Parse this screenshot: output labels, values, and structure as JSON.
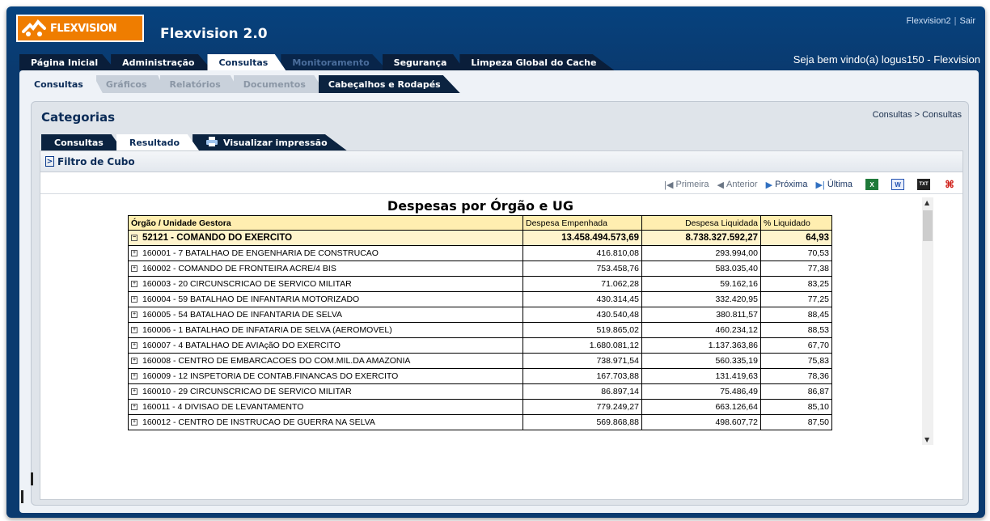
{
  "header": {
    "brand": "FLEXVISION",
    "app_title": "Flexvision 2.0",
    "user_link": "Flexvision2",
    "logout_link": "Sair",
    "welcome": "Seja bem vindo(a) logus150 - Flexvision"
  },
  "main_tabs": [
    {
      "label": "Página Inicial",
      "state": "normal"
    },
    {
      "label": "Administração",
      "state": "normal"
    },
    {
      "label": "Consultas",
      "state": "active"
    },
    {
      "label": "Monitoramento",
      "state": "disabled"
    },
    {
      "label": "Segurança",
      "state": "normal"
    },
    {
      "label": "Limpeza Global do Cache",
      "state": "normal"
    }
  ],
  "sub_tabs": [
    {
      "label": "Consultas",
      "state": "active"
    },
    {
      "label": "Gráficos",
      "state": "inactive"
    },
    {
      "label": "Relatórios",
      "state": "inactive"
    },
    {
      "label": "Documentos",
      "state": "inactive"
    },
    {
      "label": "Cabeçalhos e Rodapés",
      "state": "dark"
    }
  ],
  "section": {
    "title": "Categorias",
    "breadcrumb": "Consultas > Consultas"
  },
  "result_tabs": [
    {
      "label": "Consultas",
      "state": "normal"
    },
    {
      "label": "Resultado",
      "state": "active"
    },
    {
      "label": "Visualizar impressão",
      "state": "normal"
    }
  ],
  "filter": {
    "label": "Filtro de Cubo"
  },
  "pager": {
    "first": "Primeira",
    "prev": "Anterior",
    "next": "Próxima",
    "last": "Última"
  },
  "report": {
    "title": "Despesas por Órgão e UG",
    "headers": [
      "Órgão / Unidade Gestora",
      "Despesa Empenhada",
      "Despesa Liquidada",
      "% Liquidado"
    ],
    "group": {
      "name": "52121 - COMANDO DO EXERCITO",
      "empenhada": "13.458.494.573,69",
      "liquidada": "8.738.327.592,27",
      "pct": "64,93"
    },
    "rows": [
      {
        "name": "160001 - 7 BATALHAO DE ENGENHARIA DE CONSTRUCAO",
        "empenhada": "416.810,08",
        "liquidada": "293.994,00",
        "pct": "70,53"
      },
      {
        "name": "160002 - COMANDO DE FRONTEIRA ACRE/4 BIS",
        "empenhada": "753.458,76",
        "liquidada": "583.035,40",
        "pct": "77,38"
      },
      {
        "name": "160003 - 20 CIRCUNSCRICAO DE SERVICO MILITAR",
        "empenhada": "71.062,28",
        "liquidada": "59.162,16",
        "pct": "83,25"
      },
      {
        "name": "160004 - 59 BATALHAO DE INFANTARIA MOTORIZADO",
        "empenhada": "430.314,45",
        "liquidada": "332.420,95",
        "pct": "77,25"
      },
      {
        "name": "160005 - 54 BATALHAO DE INFANTARIA DE SELVA",
        "empenhada": "430.540,48",
        "liquidada": "380.811,57",
        "pct": "88,45"
      },
      {
        "name": "160006 - 1 BATALHAO DE INFATARIA DE SELVA (AEROMOVEL)",
        "empenhada": "519.865,02",
        "liquidada": "460.234,12",
        "pct": "88,53"
      },
      {
        "name": "160007 - 4 BATALHAO DE AVIAçãO DO EXERCITO",
        "empenhada": "1.680.081,12",
        "liquidada": "1.137.363,86",
        "pct": "67,70"
      },
      {
        "name": "160008 - CENTRO DE EMBARCACOES DO COM.MIL.DA AMAZONIA",
        "empenhada": "738.971,54",
        "liquidada": "560.335,19",
        "pct": "75,83"
      },
      {
        "name": "160009 - 12 INSPETORIA DE CONTAB.FINANCAS DO EXERCITO",
        "empenhada": "167.703,88",
        "liquidada": "131.419,63",
        "pct": "78,36"
      },
      {
        "name": "160010 - 29 CIRCUNSCRICAO DE SERVICO MILITAR",
        "empenhada": "86.897,14",
        "liquidada": "75.486,49",
        "pct": "86,87"
      },
      {
        "name": "160011 - 4 DIVISAO DE LEVANTAMENTO",
        "empenhada": "779.249,27",
        "liquidada": "663.126,64",
        "pct": "85,10"
      },
      {
        "name": "160012 - CENTRO DE INSTRUCAO DE GUERRA NA SELVA",
        "empenhada": "569.868,88",
        "liquidada": "498.607,72",
        "pct": "87,50"
      }
    ]
  },
  "colors": {
    "header_bg": "#0a3a6f",
    "brand_orange": "#ef7d00",
    "table_header": "#ffeeb0",
    "group_row": "#fff4cc"
  }
}
